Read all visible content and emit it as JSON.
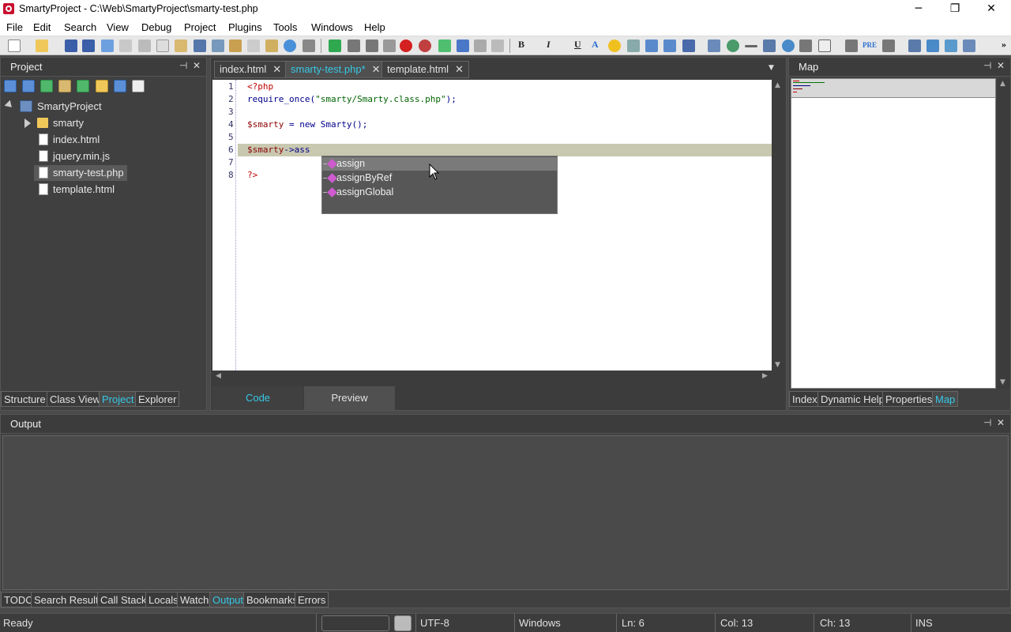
{
  "window": {
    "title": "SmartyProject - C:\\Web\\SmartyProject\\smarty-test.php",
    "minimize": "─",
    "restore": "❐",
    "close": "✕"
  },
  "menu": [
    "File",
    "Edit",
    "Search",
    "View",
    "Debug",
    "Project",
    "Plugins",
    "Tools",
    "Windows",
    "Help"
  ],
  "toolbar": {
    "bold": "B",
    "italic": "I",
    "underline": "U",
    "font_color": "A",
    "pre": "PRE",
    "overflow": "»"
  },
  "project_panel": {
    "title": "Project",
    "pin": "⊣",
    "close": "✕",
    "root": "SmartyProject",
    "items": [
      {
        "label": "smarty",
        "type": "folder"
      },
      {
        "label": "index.html",
        "type": "file"
      },
      {
        "label": "jquery.min.js",
        "type": "js"
      },
      {
        "label": "smarty-test.php",
        "type": "file",
        "selected": true
      },
      {
        "label": "template.html",
        "type": "file"
      }
    ],
    "tabs": [
      "Structure",
      "Class View",
      "Project",
      "Explorer"
    ],
    "active_tab": "Project"
  },
  "editor": {
    "tabs": [
      {
        "label": "index.html",
        "close": "✕"
      },
      {
        "label": "smarty-test.php*",
        "close": "✕",
        "active": true
      },
      {
        "label": "template.html",
        "close": "✕"
      }
    ],
    "tab_menu": "▼",
    "line_numbers": [
      "1",
      "2",
      "3",
      "4",
      "5",
      "6",
      "7",
      "8"
    ],
    "lines": {
      "l1": "<?php",
      "l2_fn": "require_once(",
      "l2_str": "\"smarty/Smarty.class.php\"",
      "l2_end": ");",
      "l4_var": "$smarty",
      "l4_rest": " = ",
      "l4_new": "new",
      "l4_end": " Smarty();",
      "l6_var": "$smarty",
      "l6_arrow": "->",
      "l6_prop": "ass",
      "l8": "?>"
    },
    "current_line": 6,
    "autocomplete": [
      "assign",
      "assignByRef",
      "assignGlobal"
    ],
    "autocomplete_selected": "assign",
    "view_tabs": [
      "Code",
      "Preview"
    ],
    "active_view": "Code"
  },
  "map_panel": {
    "title": "Map",
    "pin": "⊣",
    "close": "✕",
    "tabs": [
      "Index",
      "Dynamic Help",
      "Properties",
      "Map"
    ],
    "active_tab": "Map"
  },
  "output_panel": {
    "title": "Output",
    "pin": "⊣",
    "close": "✕",
    "tabs": [
      "TODO",
      "Search Result",
      "Call Stack",
      "Locals",
      "Watch",
      "Output",
      "Bookmarks",
      "Errors"
    ],
    "active_tab": "Output"
  },
  "status": {
    "state": "Ready",
    "encoding": "UTF-8",
    "line_endings": "Windows",
    "line": "Ln: 6",
    "col": "Col: 13",
    "ch": "Ch: 13",
    "mode": "INS"
  },
  "colors": {
    "accent": "#37c8e6",
    "panel_bg": "#404040",
    "current_line": "#c8c8b0"
  }
}
